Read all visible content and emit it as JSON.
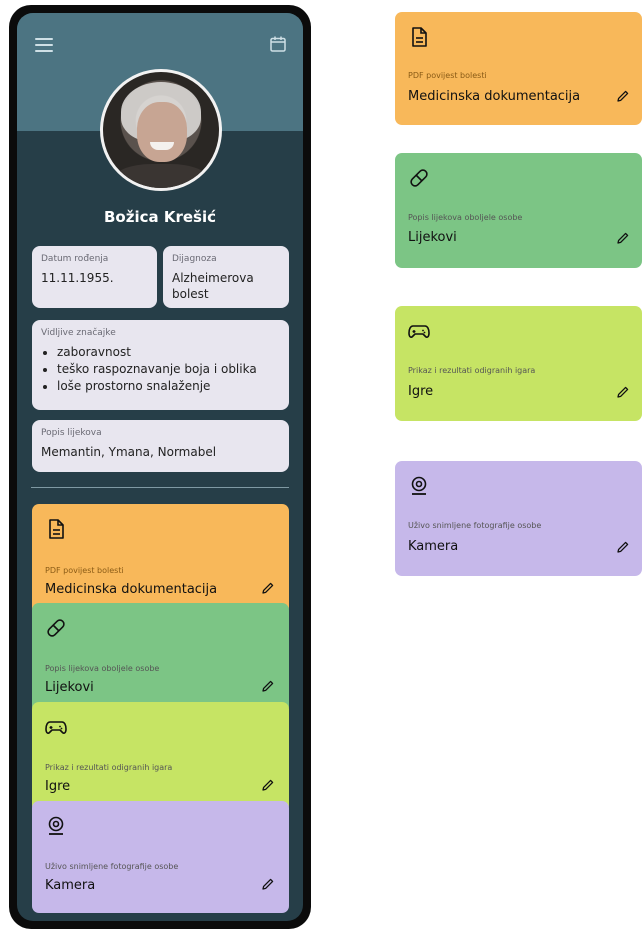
{
  "header": {
    "menu_icon": "menu-icon",
    "calendar_icon": "calendar-icon"
  },
  "patient": {
    "name": "Božica Krešić",
    "birth_label": "Datum rođenja",
    "birth_value": "11.11.1955.",
    "diagnosis_label": "Dijagnoza",
    "diagnosis_value": "Alzheimerova bolest",
    "symptoms_label": "Vidljive značajke",
    "symptoms": [
      "zaboravnost",
      "teško raspoznavanje boja i oblika",
      "loše prostorno snalaženje"
    ],
    "meds_label": "Popis lijekova",
    "meds_value": "Memantin, Ymana, Normabel"
  },
  "cards": [
    {
      "icon": "document-icon",
      "subtitle": "PDF povijest bolesti",
      "title": "Medicinska dokumentacija",
      "color": "#f8b85a"
    },
    {
      "icon": "pill-icon",
      "subtitle": "Popis lijekova oboljele osobe",
      "title": "Lijekovi",
      "color": "#7cc585"
    },
    {
      "icon": "gamepad-icon",
      "subtitle": "Prikaz i rezultati odigranih igara",
      "title": "Igre",
      "color": "#c6e464"
    },
    {
      "icon": "webcam-icon",
      "subtitle": "Uživo snimljene fotografije osobe",
      "title": "Kamera",
      "color": "#c6b8ea"
    }
  ]
}
